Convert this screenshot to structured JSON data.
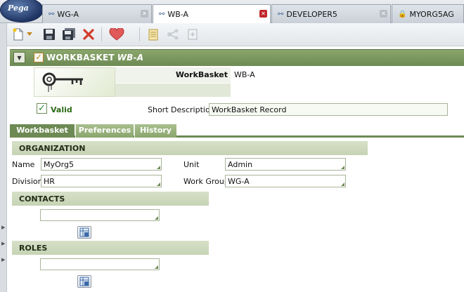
{
  "app": {
    "logo_text": "Pega"
  },
  "tabs": [
    {
      "label": "WG-A",
      "icon": "workgroup-icon",
      "active": false
    },
    {
      "label": "WB-A",
      "icon": "workbasket-icon",
      "active": true
    },
    {
      "label": "DEVELOPER5",
      "icon": "operator-icon",
      "active": false
    },
    {
      "label": "MYORG5AG",
      "icon": "access-group-icon",
      "active": false
    }
  ],
  "toolbar": {
    "icons": [
      "new-icon",
      "dropdown-arrow-icon",
      "save-icon",
      "save-as-icon",
      "delete-icon",
      "favorite-icon",
      "clipboard-icon",
      "tree-icon",
      "copy-icon"
    ]
  },
  "record": {
    "header_title": "WORKBASKET",
    "header_subtitle": "WB-A",
    "workbasket_label": "WorkBasket",
    "workbasket_value": "WB-A",
    "valid_label": "Valid",
    "short_description_label": "Short Description",
    "short_description_value": "WorkBasket Record"
  },
  "subtabs": [
    "Workbasket",
    "Preferences",
    "History"
  ],
  "organization": {
    "title": "ORGANIZATION",
    "name_label": "Name",
    "name_value": "MyOrg5",
    "unit_label": "Unit",
    "unit_value": "Admin",
    "division_label": "Division",
    "division_value": "HR",
    "workgroup_label": "Work Group",
    "workgroup_value": "WG-A"
  },
  "contacts": {
    "title": "CONTACTS"
  },
  "roles": {
    "title": "ROLES"
  },
  "colors": {
    "accent_green": "#6e8a54",
    "close_red": "#c0262b"
  }
}
